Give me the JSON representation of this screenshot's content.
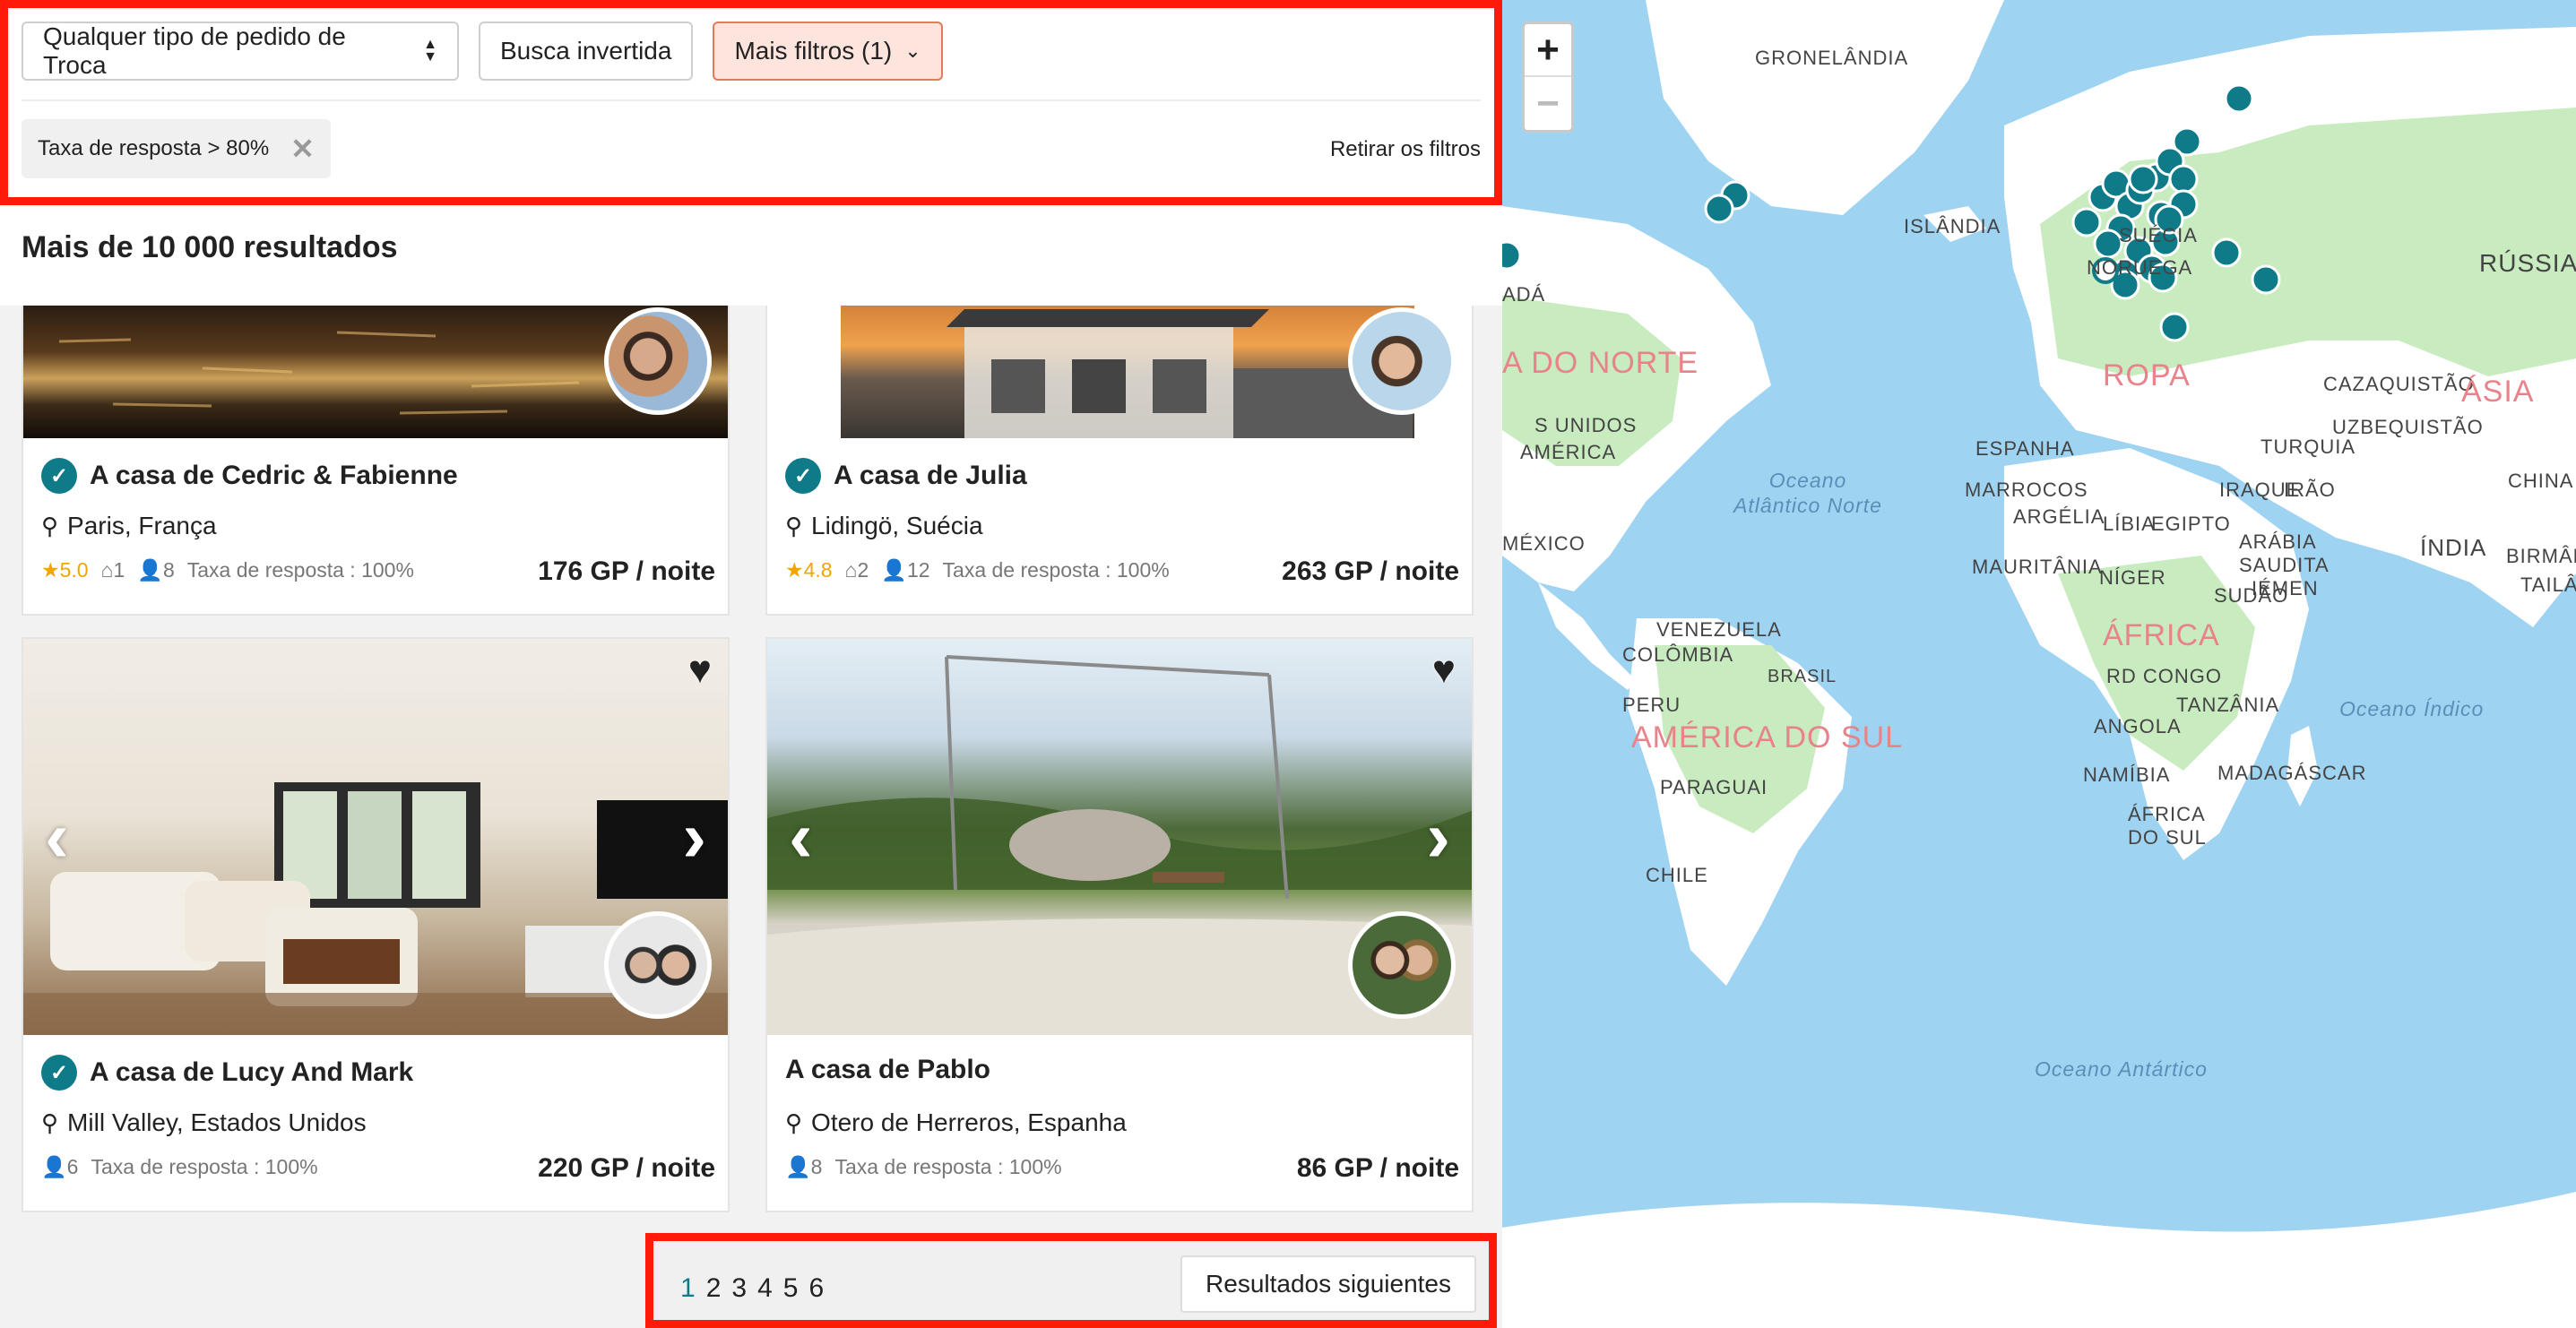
{
  "filters": {
    "exchange_type": "Qualquer tipo de pedido de Troca",
    "reverse_search": "Busca invertida",
    "more_filters": "Mais filtros (1)",
    "chip": "Taxa de resposta > 80%",
    "clear": "Retirar os filtros"
  },
  "results_title": "Mais de 10 000 resultados",
  "listings": [
    {
      "title": "A casa de Cedric & Fabienne",
      "location": "Paris, França",
      "rating": "5.0",
      "rooms": "1",
      "guests": "8",
      "response": "Taxa de resposta : 100%",
      "price": "176 GP / noite"
    },
    {
      "title": "A casa de Julia",
      "location": "Lidingö, Suécia",
      "rating": "4.8",
      "rooms": "2",
      "guests": "12",
      "response": "Taxa de resposta : 100%",
      "price": "263 GP / noite"
    },
    {
      "title": "A casa de Lucy And Mark",
      "location": "Mill Valley, Estados Unidos",
      "guests": "6",
      "response": "Taxa de resposta : 100%",
      "price": "220 GP / noite"
    },
    {
      "title": "A casa de Pablo",
      "location": "Otero de Herreros, Espanha",
      "guests": "8",
      "response": "Taxa de resposta : 100%",
      "price": "86 GP / noite"
    }
  ],
  "pagination": {
    "pages": [
      "1",
      "2",
      "3",
      "4",
      "5",
      "6"
    ],
    "next": "Resultados siguientes"
  },
  "map": {
    "zoom_in": "+",
    "zoom_out": "−",
    "labels": [
      "GRONELÂNDIA",
      "ISLÂNDIA",
      "SUÉCIA",
      "NORUEGA",
      "RÚSSIA",
      "ADÁ",
      "A DO NORTE",
      "S UNIDOS",
      "AMÉRICA",
      "ROPA",
      "ESPANHA",
      "CAZAQUISTÃO",
      "ÁSIA",
      "UZBEQUISTÃO",
      "TURQUIA",
      "CHINA",
      "MARROCOS",
      "ARGÉLIA",
      "LÍBIA",
      "EGIPTO",
      "IRAQUE",
      "IRÃO",
      "ARÁBIA SAUDITA",
      "ÍNDIA",
      "BIRMÂNIA",
      "TAILÂN",
      "MÉXICO",
      "MAURITÂNIA",
      "NÍGER",
      "SUDÃO",
      "IÉMEN",
      "ÁFRICA",
      "VENEZUELA",
      "COLÔMBIA",
      "RD CONGO",
      "TANZÂNIA",
      "PERU",
      "AMÉRICA DO SUL",
      "ANGOLA",
      "BRASIL",
      "PARAGUAI",
      "NAMÍBIA",
      "MADAGÁSCAR",
      "ÁFRICA DO SUL",
      "CHILE",
      "Oceano Atlântico Norte",
      "Oceano Índico",
      "Oceano Antártico"
    ],
    "colors": {
      "water": "#9fd3f2",
      "land": "#ffffff",
      "green": "#c9ebc0",
      "pin": "#0f7a88"
    }
  }
}
